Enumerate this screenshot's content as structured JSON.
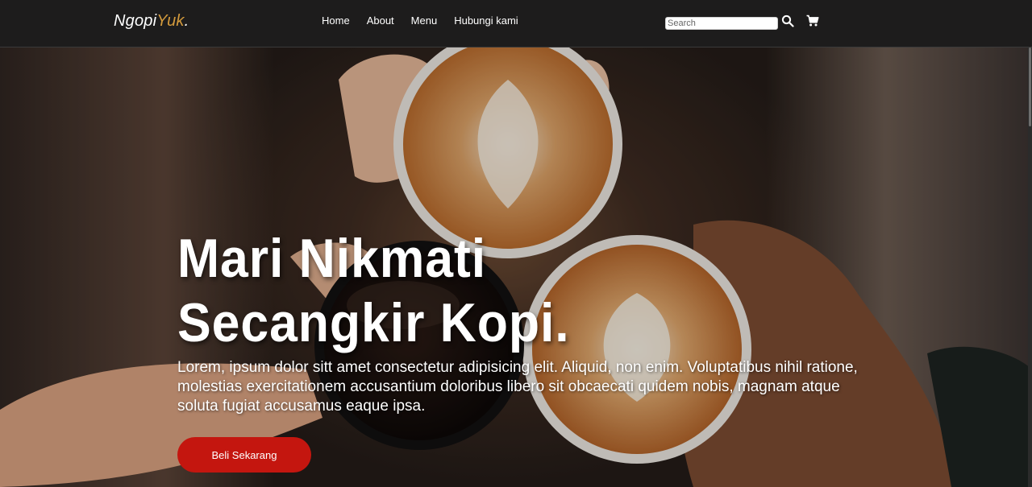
{
  "navbar": {
    "logo": {
      "main": "Ngopi",
      "accent": "Yuk",
      "dot": "."
    },
    "links": [
      {
        "label": "Home"
      },
      {
        "label": "About"
      },
      {
        "label": "Menu"
      },
      {
        "label": "Hubungi kami"
      }
    ],
    "search": {
      "placeholder": "Search",
      "value": ""
    },
    "icons": [
      "search-icon",
      "shopping-cart-icon"
    ]
  },
  "hero": {
    "title": "Mari Nikmati Secangkir Kopi.",
    "text": "Lorem, ipsum dolor sitt amet consectetur adipisicing elit. Aliquid, non enim. Voluptatibus nihil ratione, molestias exercitationem accusantium doloribus libero sit obcaecati quidem nobis, magnam atque soluta fugiat accusamus eaque ipsa.",
    "cta_label": "Beli Sekarang",
    "background_image": "coffee-cups-toast-photo"
  },
  "colors": {
    "navbar_bg": "#1d1c1c",
    "logo_accent": "#d39a3c",
    "cta_bg": "#c4160f",
    "text": "#ffffff"
  }
}
